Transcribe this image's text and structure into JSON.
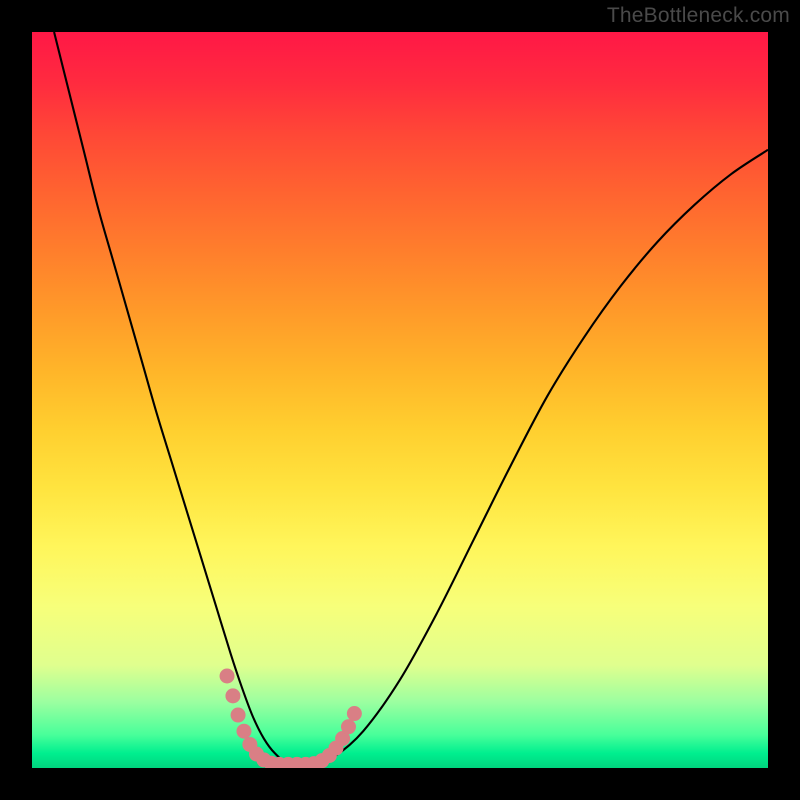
{
  "watermark": "TheBottleneck.com",
  "chart_data": {
    "type": "line",
    "title": "",
    "xlabel": "",
    "ylabel": "",
    "xlim": [
      0,
      100
    ],
    "ylim": [
      0,
      100
    ],
    "grid": false,
    "legend": false,
    "series": [
      {
        "name": "curve",
        "x": [
          3,
          5,
          7,
          9,
          11,
          13,
          15,
          17,
          19,
          21,
          23,
          25,
          27,
          28.5,
          30,
          31.5,
          33,
          35,
          38,
          41,
          45,
          50,
          55,
          60,
          65,
          70,
          75,
          80,
          85,
          90,
          95,
          100
        ],
        "y": [
          100,
          92,
          84,
          76,
          69,
          62,
          55,
          48,
          41.5,
          35,
          28.5,
          22,
          15.5,
          11,
          7,
          4,
          2,
          0.5,
          0.4,
          1.5,
          5,
          12,
          21,
          31,
          41,
          50.5,
          58.5,
          65.5,
          71.5,
          76.5,
          80.7,
          84
        ]
      }
    ],
    "highlight_dots": {
      "name": "highlighted-range",
      "color": "#d97f85",
      "points": [
        {
          "x": 26.5,
          "y": 12.5
        },
        {
          "x": 27.3,
          "y": 9.8
        },
        {
          "x": 28.0,
          "y": 7.2
        },
        {
          "x": 28.8,
          "y": 5.0
        },
        {
          "x": 29.6,
          "y": 3.2
        },
        {
          "x": 30.5,
          "y": 1.9
        },
        {
          "x": 31.5,
          "y": 1.1
        },
        {
          "x": 32.5,
          "y": 0.65
        },
        {
          "x": 33.6,
          "y": 0.5
        },
        {
          "x": 34.8,
          "y": 0.5
        },
        {
          "x": 36.0,
          "y": 0.5
        },
        {
          "x": 37.2,
          "y": 0.5
        },
        {
          "x": 38.3,
          "y": 0.6
        },
        {
          "x": 39.4,
          "y": 1.0
        },
        {
          "x": 40.4,
          "y": 1.7
        },
        {
          "x": 41.3,
          "y": 2.7
        },
        {
          "x": 42.2,
          "y": 4.0
        },
        {
          "x": 43.0,
          "y": 5.6
        },
        {
          "x": 43.8,
          "y": 7.4
        }
      ]
    }
  }
}
